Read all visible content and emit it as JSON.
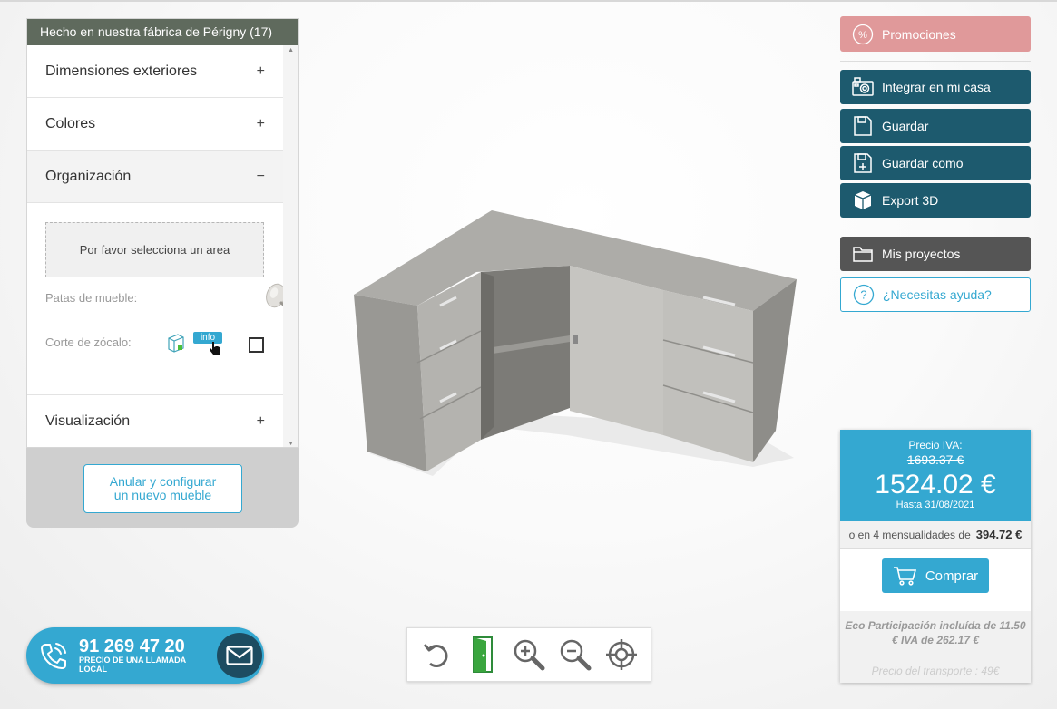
{
  "left_panel": {
    "header": "Hecho en nuestra fábrica de Périgny (17)",
    "sections": [
      {
        "label": "Dimensiones exteriores",
        "sign": "+"
      },
      {
        "label": "Colores",
        "sign": "+"
      },
      {
        "label": "Organización",
        "sign": "−"
      },
      {
        "label": "Visualización",
        "sign": "+"
      }
    ],
    "organizacion": {
      "area_prompt": "Por favor selecciona un area",
      "patas_label": "Patas de mueble:",
      "corte_label": "Corte de zócalo:",
      "info_badge": "info",
      "corte_checked": false
    },
    "cancel_button": {
      "line1": "Anular y configurar",
      "line2": "un nuevo mueble"
    }
  },
  "phone": {
    "number": "91 269 47 20",
    "subtitle": "PRECIO DE UNA LLAMADA LOCAL"
  },
  "toolbar": {
    "icons": [
      "rotate-icon",
      "door-icon",
      "zoom-in-icon",
      "zoom-out-icon",
      "target-icon"
    ]
  },
  "right_panel": {
    "promo": "Promociones",
    "integrate": "Integrar en mi casa",
    "save": "Guardar",
    "save_as": "Guardar como",
    "export": "Export 3D",
    "projects": "Mis proyectos",
    "help": "¿Necesitas ayuda?"
  },
  "price": {
    "label": "Precio IVA:",
    "old": "1693.37 €",
    "new": "1524.02 €",
    "until": "Hasta 31/08/2021",
    "installments_text": "o en 4 mensualidades de",
    "installments_value": "394.72 €",
    "buy": "Comprar",
    "eco_line1": "Eco Participación incluída de 11.50",
    "eco_line2": "€ IVA de 262.17 €",
    "transport": "Precio del transporte : 49€"
  },
  "colors": {
    "accent": "#34a8d1",
    "teal": "#1d5a6e",
    "promo": "#e0999a",
    "header_green": "#5f6a5d"
  }
}
